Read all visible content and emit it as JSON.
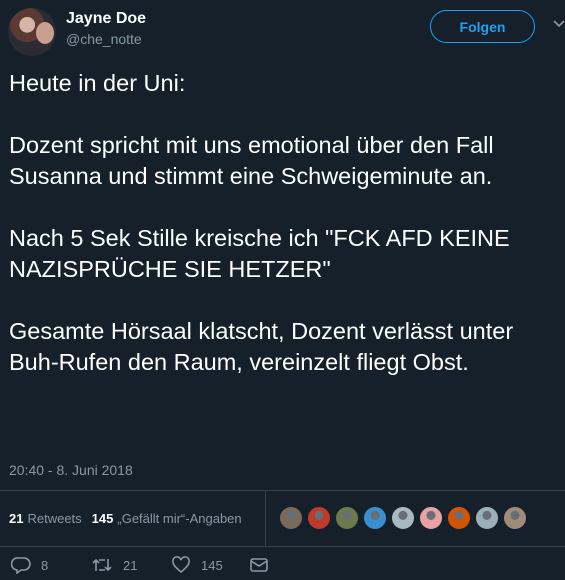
{
  "user": {
    "name": "Jayne Doe",
    "handle": "@che_notte"
  },
  "follow_label": "Folgen",
  "tweet": {
    "text": "Heute in der Uni:\n\nDozent spricht mit uns emotional über den Fall Susanna und stimmt eine Schweigeminute an.\n\nNach 5 Sek Stille kreische ich \"FCK AFD KEINE NAZISPRÜCHE SIE HETZER\"\n\nGesamte Hörsaal klatscht, Dozent verlässt unter Buh-Rufen den Raum, vereinzelt fliegt Obst.",
    "timestamp": "20:40 - 8. Juni 2018"
  },
  "stats": {
    "retweets_count": "21",
    "retweets_label": "Retweets",
    "likes_count": "145",
    "likes_label": "„Gefällt mir“-Angaben"
  },
  "likers": [
    {
      "icon": "user-avatar",
      "color": "#7a6a5a"
    },
    {
      "icon": "user-avatar",
      "color": "#c0392b"
    },
    {
      "icon": "user-avatar",
      "color": "#6b7a4a"
    },
    {
      "icon": "user-avatar",
      "color": "#3a8fd0"
    },
    {
      "icon": "default-avatar",
      "color": "#aab8c2"
    },
    {
      "icon": "user-avatar",
      "color": "#e8a0a0"
    },
    {
      "icon": "user-avatar",
      "color": "#d35400"
    },
    {
      "icon": "user-avatar",
      "color": "#9ab0b8"
    },
    {
      "icon": "user-avatar",
      "color": "#a08a78"
    }
  ],
  "actions": {
    "reply_count": "8",
    "retweet_count": "21",
    "like_count": "145"
  },
  "colors": {
    "background": "#15202b",
    "accent": "#1da1f2",
    "secondary_text": "#8899a6",
    "border": "#38444d"
  }
}
